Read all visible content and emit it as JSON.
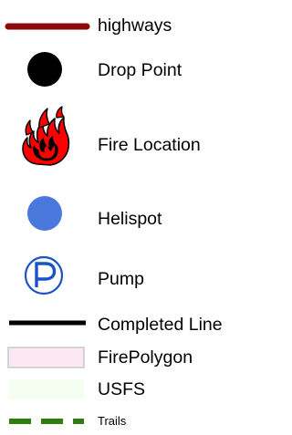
{
  "legend": {
    "items": [
      {
        "label": "highways",
        "symbol": "line-icon",
        "color": "#8b0a0a"
      },
      {
        "label": "Drop Point",
        "symbol": "black-circle-icon",
        "color": "#000000"
      },
      {
        "label": "Fire Location",
        "symbol": "fire-icon",
        "color": "#ff0000"
      },
      {
        "label": "Helispot",
        "symbol": "blue-circle-icon",
        "color": "#4a78dd"
      },
      {
        "label": "Pump",
        "symbol": "circled-p-icon",
        "color": "#1a52c8"
      },
      {
        "label": "Completed Line",
        "symbol": "line-icon",
        "color": "#000000"
      },
      {
        "label": "FirePolygon",
        "symbol": "filled-box-icon",
        "fill": "#fce8f2",
        "stroke": "#c8c8c8"
      },
      {
        "label": "USFS",
        "symbol": "filled-box-icon",
        "fill": "#f4fff2"
      },
      {
        "label": "Trails",
        "symbol": "dashed-line-icon",
        "color": "#2e7d0f"
      }
    ]
  }
}
